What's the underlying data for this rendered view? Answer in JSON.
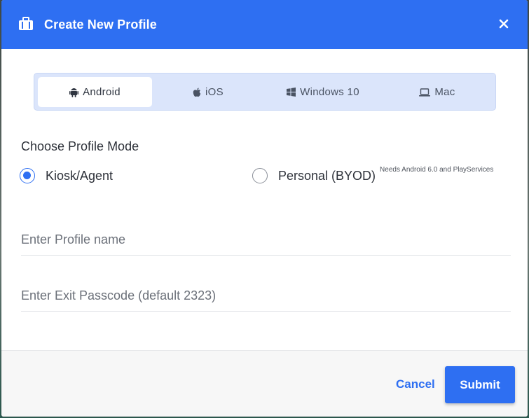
{
  "dialog": {
    "title": "Create New Profile",
    "close_icon": "close-icon",
    "header_icon": "briefcase-icon"
  },
  "tabs": [
    {
      "label": "Android",
      "icon": "android-icon",
      "active": true
    },
    {
      "label": "iOS",
      "icon": "apple-icon",
      "active": false
    },
    {
      "label": "Windows 10",
      "icon": "windows-icon",
      "active": false
    },
    {
      "label": "Mac",
      "icon": "laptop-icon",
      "active": false
    }
  ],
  "mode": {
    "title": "Choose Profile Mode",
    "options": [
      {
        "label": "Kiosk/Agent",
        "checked": true,
        "note": ""
      },
      {
        "label": "Personal (BYOD)",
        "checked": false,
        "note": "Needs Android 6.0 and PlayServices"
      }
    ]
  },
  "fields": {
    "profile_name": {
      "value": "",
      "placeholder": "Enter Profile name"
    },
    "exit_passcode": {
      "value": "",
      "placeholder": "Enter Exit Passcode (default 2323)"
    }
  },
  "footer": {
    "cancel_label": "Cancel",
    "submit_label": "Submit"
  },
  "colors": {
    "accent": "#2e6ff2",
    "tab_bar": "#dbe5fb"
  }
}
